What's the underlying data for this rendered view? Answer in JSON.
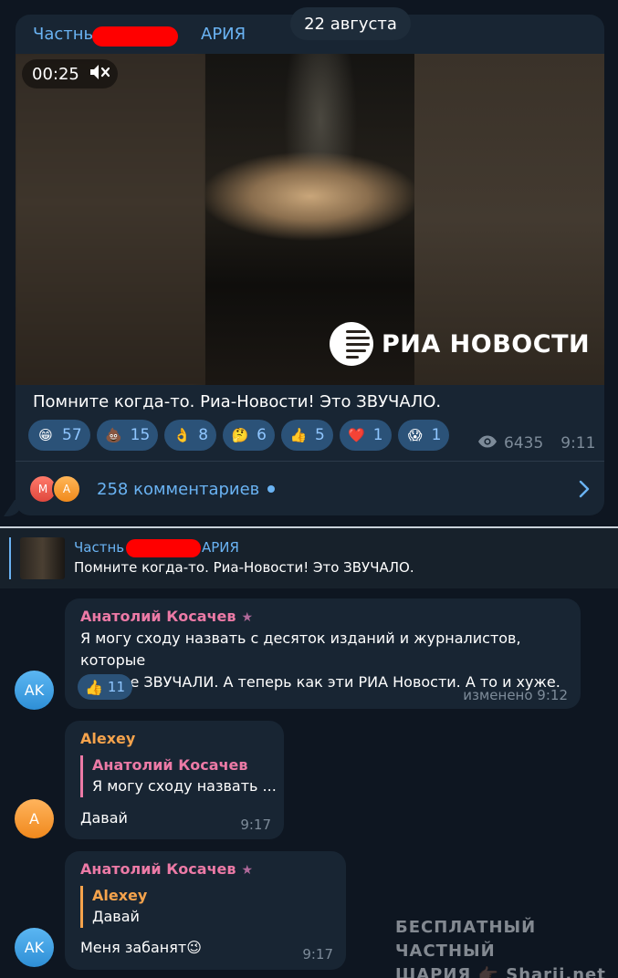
{
  "channel_post": {
    "date": "22 августа",
    "channel_name_start": "Частнь",
    "channel_name_end": "АРИЯ",
    "video_time": "00:25",
    "watermark_logo_text": "РИА НОВОСТИ",
    "caption": "Помните когда-то. Риа-Новости! Это ЗВУЧАЛО.",
    "reactions": [
      {
        "emoji": "😁",
        "count": "57"
      },
      {
        "emoji": "💩",
        "count": "15"
      },
      {
        "emoji": "👌",
        "count": "8"
      },
      {
        "emoji": "🤔",
        "count": "6"
      },
      {
        "emoji": "👍",
        "count": "5"
      },
      {
        "emoji": "❤️",
        "count": "1"
      },
      {
        "emoji": "😱",
        "count": "1"
      }
    ],
    "views": "6435",
    "time": "9:11",
    "comment_avatars": [
      "M",
      "A"
    ],
    "comments_label": "258 комментариев"
  },
  "pinned": {
    "title_start": "Частнь",
    "title_end": "АРИЯ",
    "text": "Помните когда-то. Риа-Новости! Это ЗВУЧАЛО."
  },
  "messages": [
    {
      "avatar": "AK",
      "author": "Анатолий Косачев",
      "text_line1": "Я могу сходу назвать с десяток изданий и журналистов, которые",
      "text_line2": "раньше ЗВУЧАЛИ. А теперь как эти РИА Новости. А то и хуже.",
      "reaction_emoji": "👍",
      "reaction_count": "11",
      "meta": "изменено 9:12"
    },
    {
      "avatar": "A",
      "author": "Alexey",
      "reply_author": "Анатолий Косачев",
      "reply_text": "Я могу сходу назвать ...",
      "text": "Давай",
      "meta": "9:17"
    },
    {
      "avatar": "AK",
      "author": "Анатолий Косачев",
      "reply_author": "Alexey",
      "reply_text": "Давай",
      "text": "Меня забанят😉",
      "meta": "9:17"
    }
  ],
  "watermark": {
    "line1": "БЕСПЛАТНЫЙ ЧАСТНЫЙ",
    "line2": "ШАРИЯ 👉🏿 Sharij.net"
  },
  "colors": {
    "background": "#0e1621",
    "bubble": "#182533",
    "link_blue": "#6ab3f3",
    "reaction_bg": "#2b5278",
    "author_pink": "#ec7aa6",
    "author_orange": "#f5a34c",
    "redaction": "#ff0000"
  }
}
